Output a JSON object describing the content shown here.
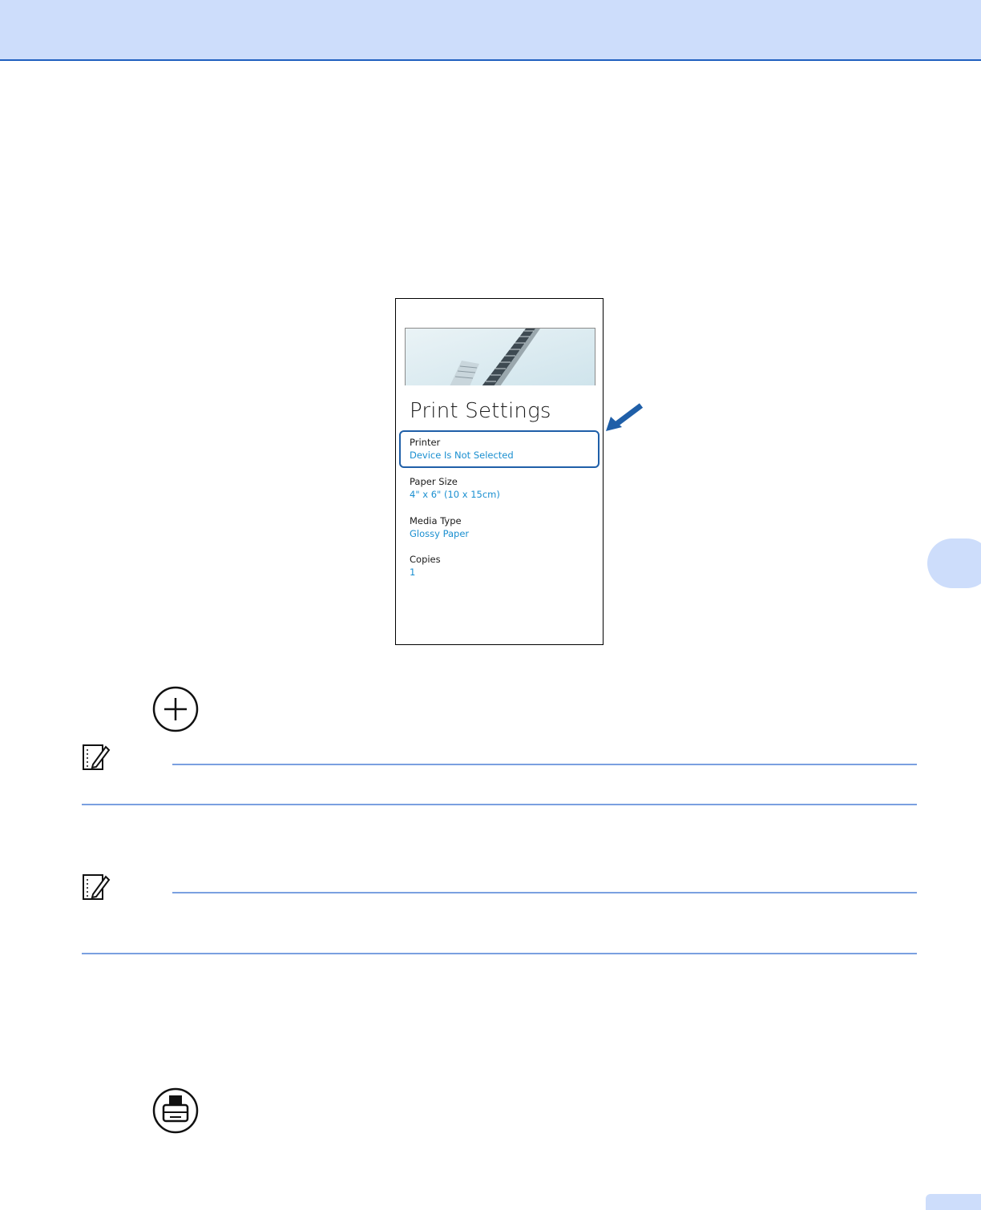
{
  "document": {
    "colors": {
      "band": "#cdddfb",
      "accent": "#1f5fbf",
      "link": "#1a8fd0"
    }
  },
  "screenshot": {
    "title": "Print Settings",
    "settings": [
      {
        "label": "Printer",
        "value": "Device Is Not Selected",
        "highlighted": true
      },
      {
        "label": "Paper Size",
        "value": "4\" x 6\" (10 x 15cm)"
      },
      {
        "label": "Media Type",
        "value": "Glossy Paper"
      },
      {
        "label": "Copies",
        "value": "1"
      }
    ]
  },
  "icons": {
    "add": "plus-circle-icon",
    "printer": "printer-circle-icon",
    "note": "note-pencil-icon",
    "pointer": "arrow-icon"
  }
}
